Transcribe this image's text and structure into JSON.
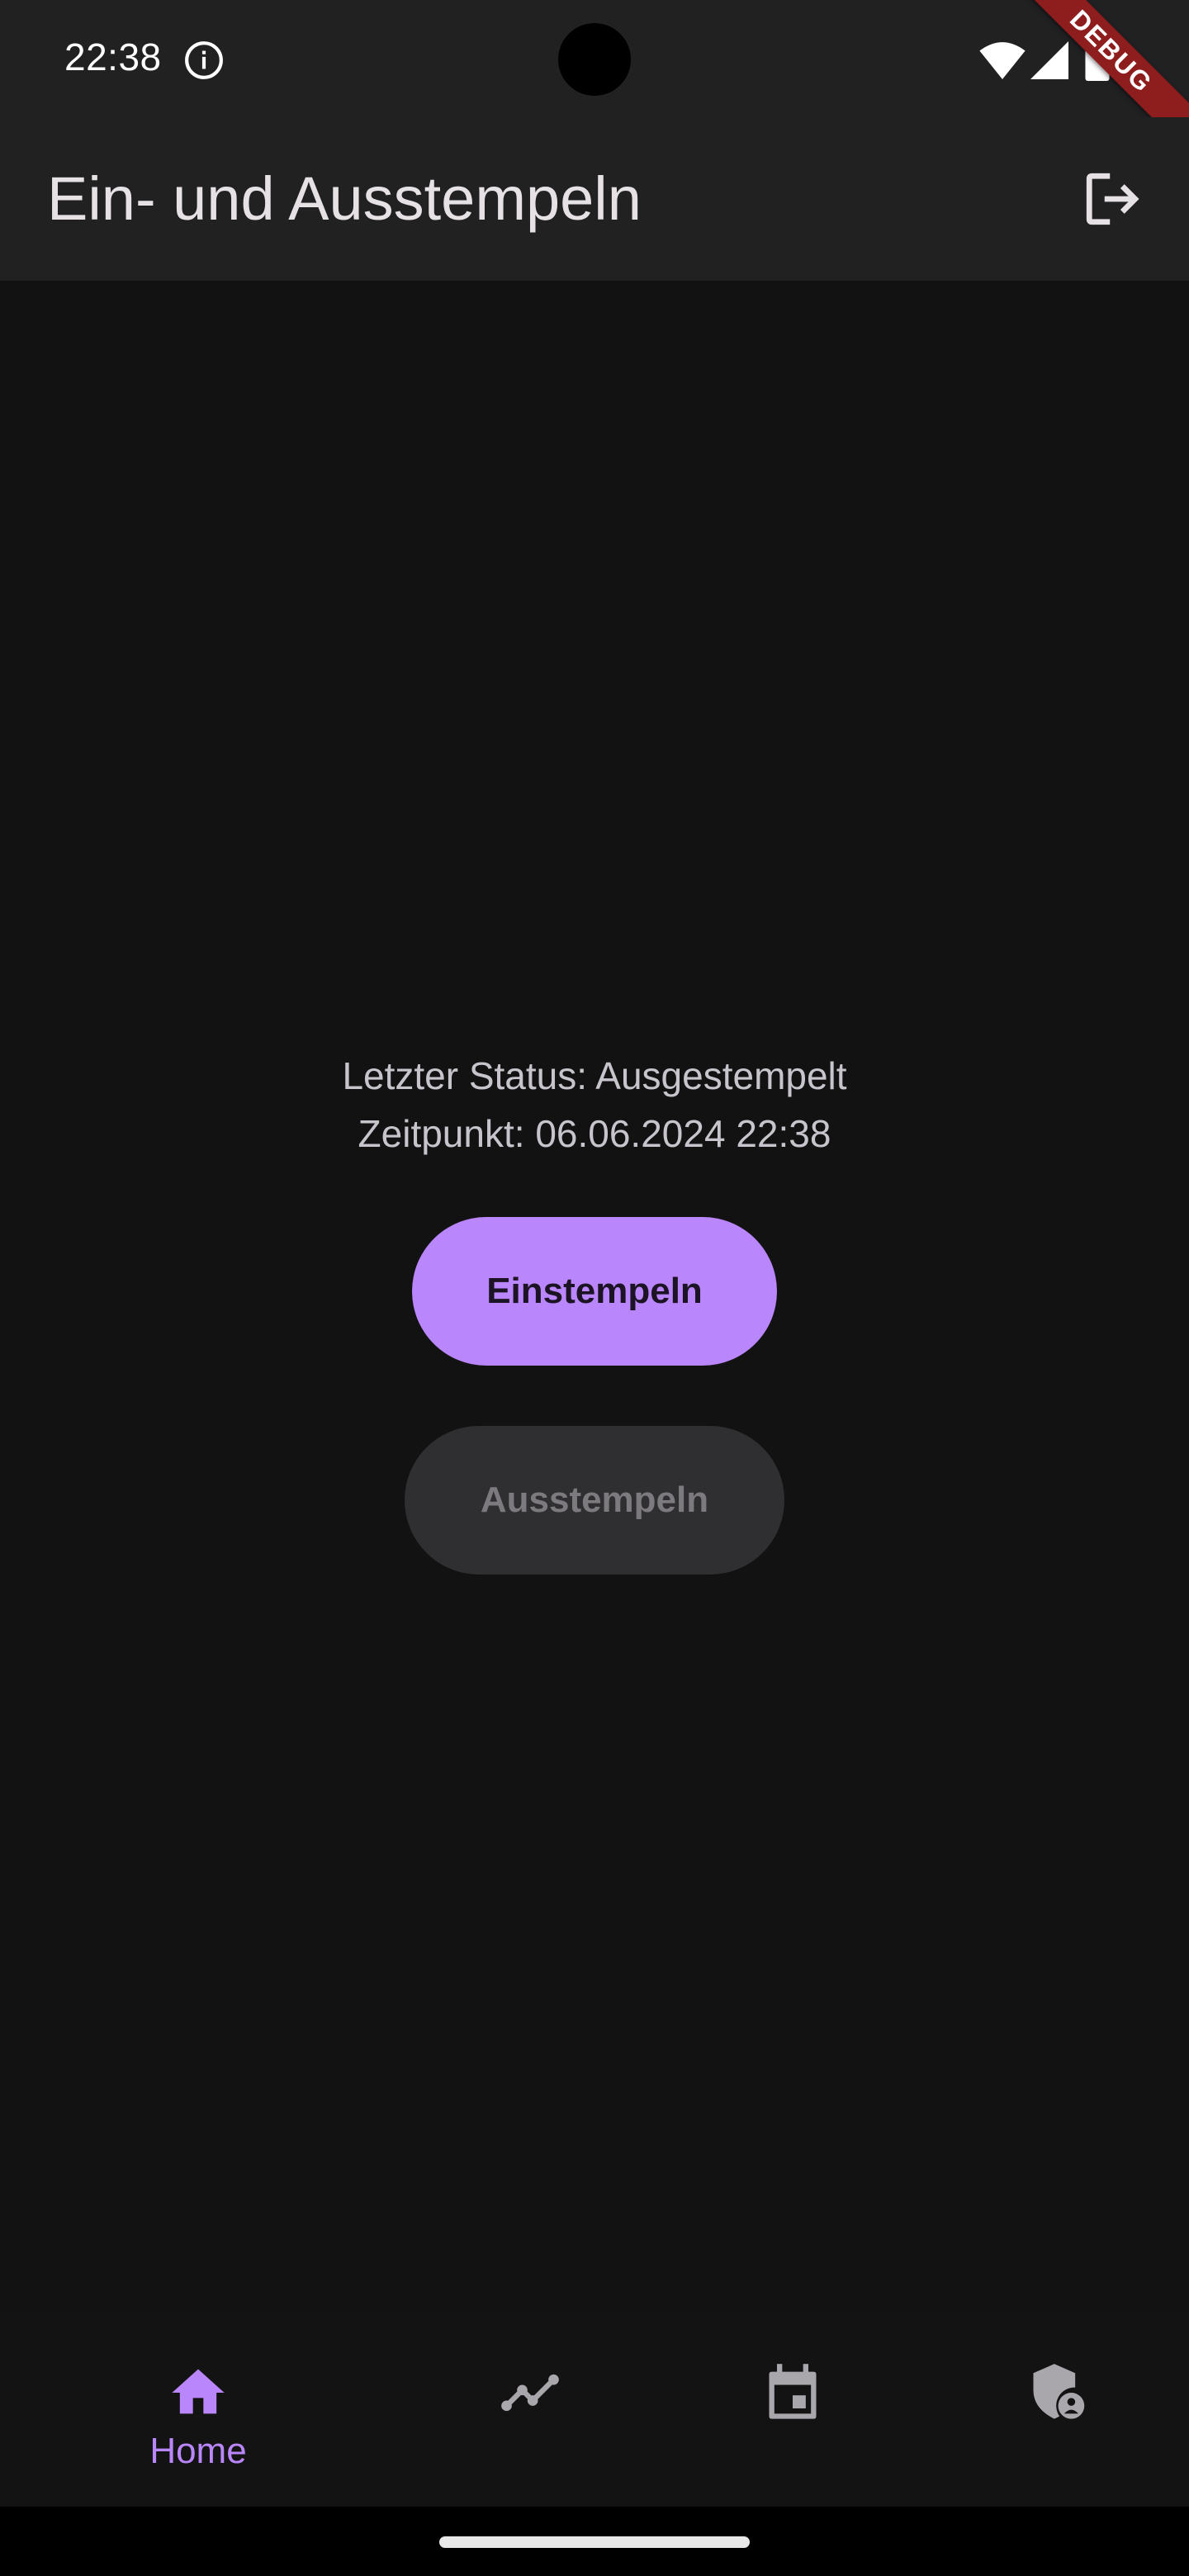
{
  "status_bar": {
    "time": "22:38",
    "debug_banner": "DEBUG"
  },
  "app_bar": {
    "title": "Ein- und Ausstempeln"
  },
  "main": {
    "last_status": "Letzter Status: Ausgestempelt",
    "timestamp": "Zeitpunkt: 06.06.2024 22:38",
    "clock_in_label": "Einstempeln",
    "clock_out_label": "Ausstempeln"
  },
  "bottom_nav": {
    "items": [
      {
        "icon": "home-icon",
        "label": "Home",
        "selected": true
      },
      {
        "icon": "timeline-icon",
        "label": "",
        "selected": false
      },
      {
        "icon": "calendar-icon",
        "label": "",
        "selected": false
      },
      {
        "icon": "admin-shield-icon",
        "label": "",
        "selected": false
      }
    ]
  },
  "colors": {
    "accent": "#ba86fb",
    "background": "#121213",
    "app_bar": "#212122",
    "disabled_button": "#2f2e30",
    "debug_banner": "#8e1d1d"
  }
}
